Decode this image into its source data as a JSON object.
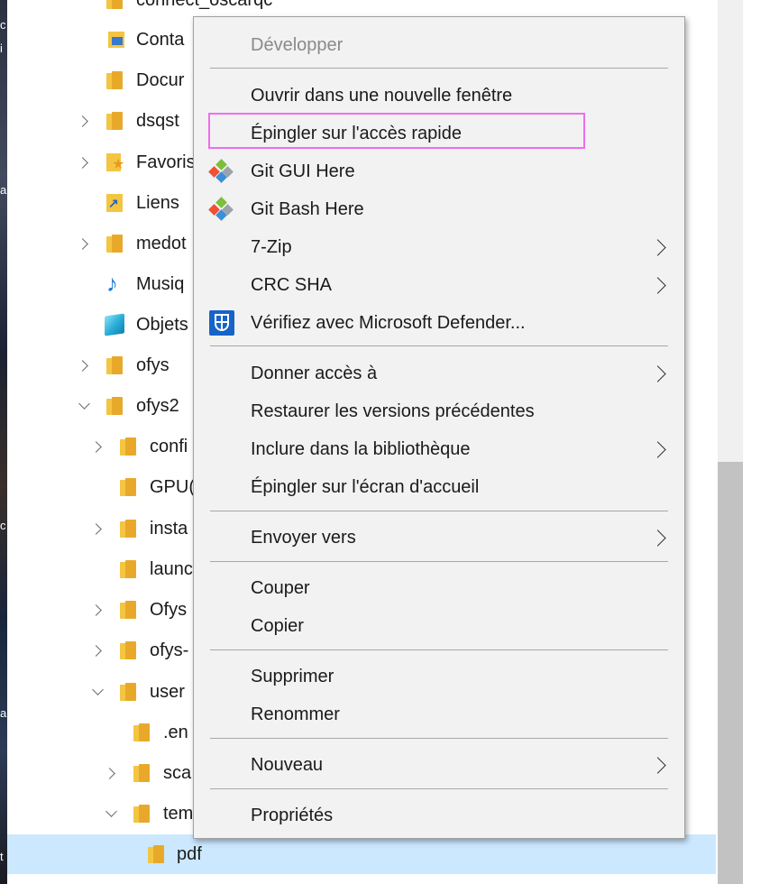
{
  "tree": {
    "rows": [
      {
        "label": "connect_oscarqc"
      },
      {
        "label": "Conta"
      },
      {
        "label": "Docur"
      },
      {
        "label": "dsqst"
      },
      {
        "label": "Favoris"
      },
      {
        "label": "Liens"
      },
      {
        "label": "medot"
      },
      {
        "label": "Musiq"
      },
      {
        "label": "Objets"
      },
      {
        "label": "ofys"
      },
      {
        "label": "ofys2"
      },
      {
        "label": "confi"
      },
      {
        "label": "GPU("
      },
      {
        "label": "insta"
      },
      {
        "label": "launc"
      },
      {
        "label": "Ofys"
      },
      {
        "label": "ofys-"
      },
      {
        "label": "user"
      },
      {
        "label": ".en"
      },
      {
        "label": "sca"
      },
      {
        "label": "tem"
      },
      {
        "label": "pdf"
      }
    ]
  },
  "desktop_chars": [
    "c",
    "i",
    "",
    "",
    "a",
    "",
    "",
    "",
    "",
    "",
    "",
    "",
    "c",
    "",
    "",
    "",
    "",
    "a",
    "",
    "",
    "",
    "t"
  ],
  "menu": {
    "items": [
      {
        "label": "Développer"
      },
      {
        "label": "Ouvrir dans une nouvelle fenêtre"
      },
      {
        "label": "Épingler sur l'accès rapide"
      },
      {
        "label": "Git GUI Here"
      },
      {
        "label": "Git Bash Here"
      },
      {
        "label": "7-Zip"
      },
      {
        "label": "CRC SHA"
      },
      {
        "label": "Vérifiez avec Microsoft Defender..."
      },
      {
        "label": "Donner accès à"
      },
      {
        "label": "Restaurer les versions précédentes"
      },
      {
        "label": "Inclure dans la bibliothèque"
      },
      {
        "label": "Épingler sur l'écran d'accueil"
      },
      {
        "label": "Envoyer vers"
      },
      {
        "label": "Couper"
      },
      {
        "label": "Copier"
      },
      {
        "label": "Supprimer"
      },
      {
        "label": "Renommer"
      },
      {
        "label": "Nouveau"
      },
      {
        "label": "Propriétés"
      }
    ]
  },
  "colors": {
    "selection": "#cce8ff",
    "highlight_box": "#f06cf0",
    "menu_bg": "#f2f2f2",
    "folder": "#e8a92b"
  }
}
